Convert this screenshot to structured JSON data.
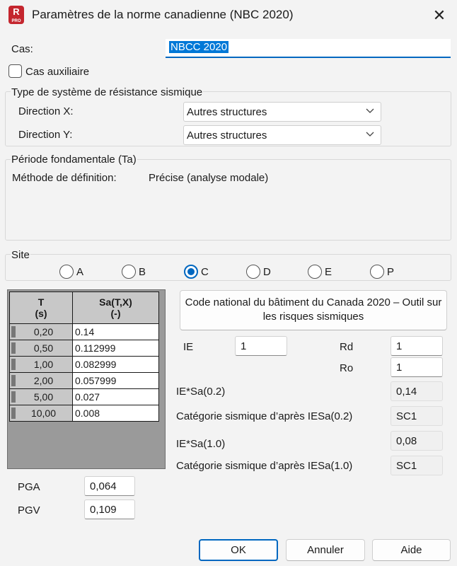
{
  "window": {
    "title": "Paramètres de la norme canadienne (NBC 2020)",
    "icon_letter": "R",
    "icon_sub": "PRO",
    "close_glyph": "✕"
  },
  "cas": {
    "label": "Cas:",
    "value": "NBCC 2020"
  },
  "cas_auxiliaire": {
    "label": "Cas auxiliaire",
    "checked": false
  },
  "seismic_system": {
    "title": "Type de système de résistance sismique",
    "direction_x": {
      "label": "Direction X:",
      "value": "Autres structures"
    },
    "direction_y": {
      "label": "Direction Y:",
      "value": "Autres structures"
    }
  },
  "period": {
    "title": "Période fondamentale (Ta)",
    "method_label": "Méthode de définition:",
    "method_value": "Précise (analyse modale)"
  },
  "site": {
    "title": "Site",
    "options": [
      "A",
      "B",
      "C",
      "D",
      "E",
      "P"
    ],
    "selected": "C"
  },
  "spectrum_table": {
    "headers": [
      "T\n(s)",
      "Sa(T,X)\n(-)"
    ],
    "rows": [
      {
        "t": "0,20",
        "sa": "0.14"
      },
      {
        "t": "0,50",
        "sa": "0.112999"
      },
      {
        "t": "1,00",
        "sa": "0.082999"
      },
      {
        "t": "2,00",
        "sa": "0.057999"
      },
      {
        "t": "5,00",
        "sa": "0.027"
      },
      {
        "t": "10,00",
        "sa": "0.008"
      }
    ]
  },
  "tool_button": {
    "label": "Code national du bâtiment du Canada 2020 – Outil sur les risques sismiques"
  },
  "params": {
    "ie_label": "IE",
    "ie_value": "1",
    "rd_label": "Rd",
    "rd_value": "1",
    "ro_label": "Ro",
    "ro_value": "1",
    "ie_sa02_label": "IE*Sa(0.2)",
    "ie_sa02_value": "0,14",
    "cat02_label": "Catégorie sismique d’après IESa(0.2)",
    "cat02_value": "SC1",
    "ie_sa10_label": "IE*Sa(1.0)",
    "ie_sa10_value": "0,08",
    "cat10_label": "Catégorie sismique d’après IESa(1.0)",
    "cat10_value": "SC1"
  },
  "pga": {
    "label": "PGA",
    "value": "0,064"
  },
  "pgv": {
    "label": "PGV",
    "value": "0,109"
  },
  "buttons": {
    "ok": "OK",
    "cancel": "Annuler",
    "help": "Aide"
  },
  "colors": {
    "accent": "#0067c0",
    "selection": "#0078d7",
    "brand": "#c4262e"
  }
}
